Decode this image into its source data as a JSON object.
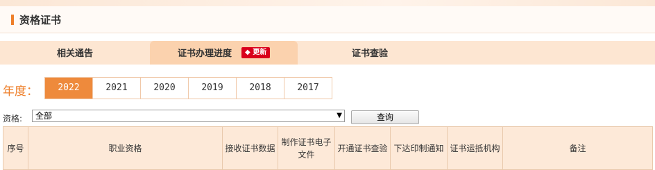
{
  "header": {
    "title": "资格证书"
  },
  "tabs": [
    {
      "label": "相关通告",
      "active": false
    },
    {
      "label": "证书办理进度",
      "active": true,
      "badge": "更新"
    },
    {
      "label": "证书查验",
      "active": false
    }
  ],
  "year_filter": {
    "label": "年度：",
    "years": [
      "2022",
      "2021",
      "2020",
      "2019",
      "2018",
      "2017"
    ],
    "selected": "2022"
  },
  "qualification_filter": {
    "label": "资格:",
    "selected": "全部",
    "search_button": "查询"
  },
  "table": {
    "columns": [
      "序号",
      "职业资格",
      "接收证书数据",
      "制作证书电子文件",
      "开通证书查验",
      "下达印制通知",
      "证书运抵机构",
      "备注"
    ]
  },
  "colors": {
    "accent": "#ee7f2a",
    "badge": "#d9001b",
    "tab_bg": "#fde6d2"
  }
}
